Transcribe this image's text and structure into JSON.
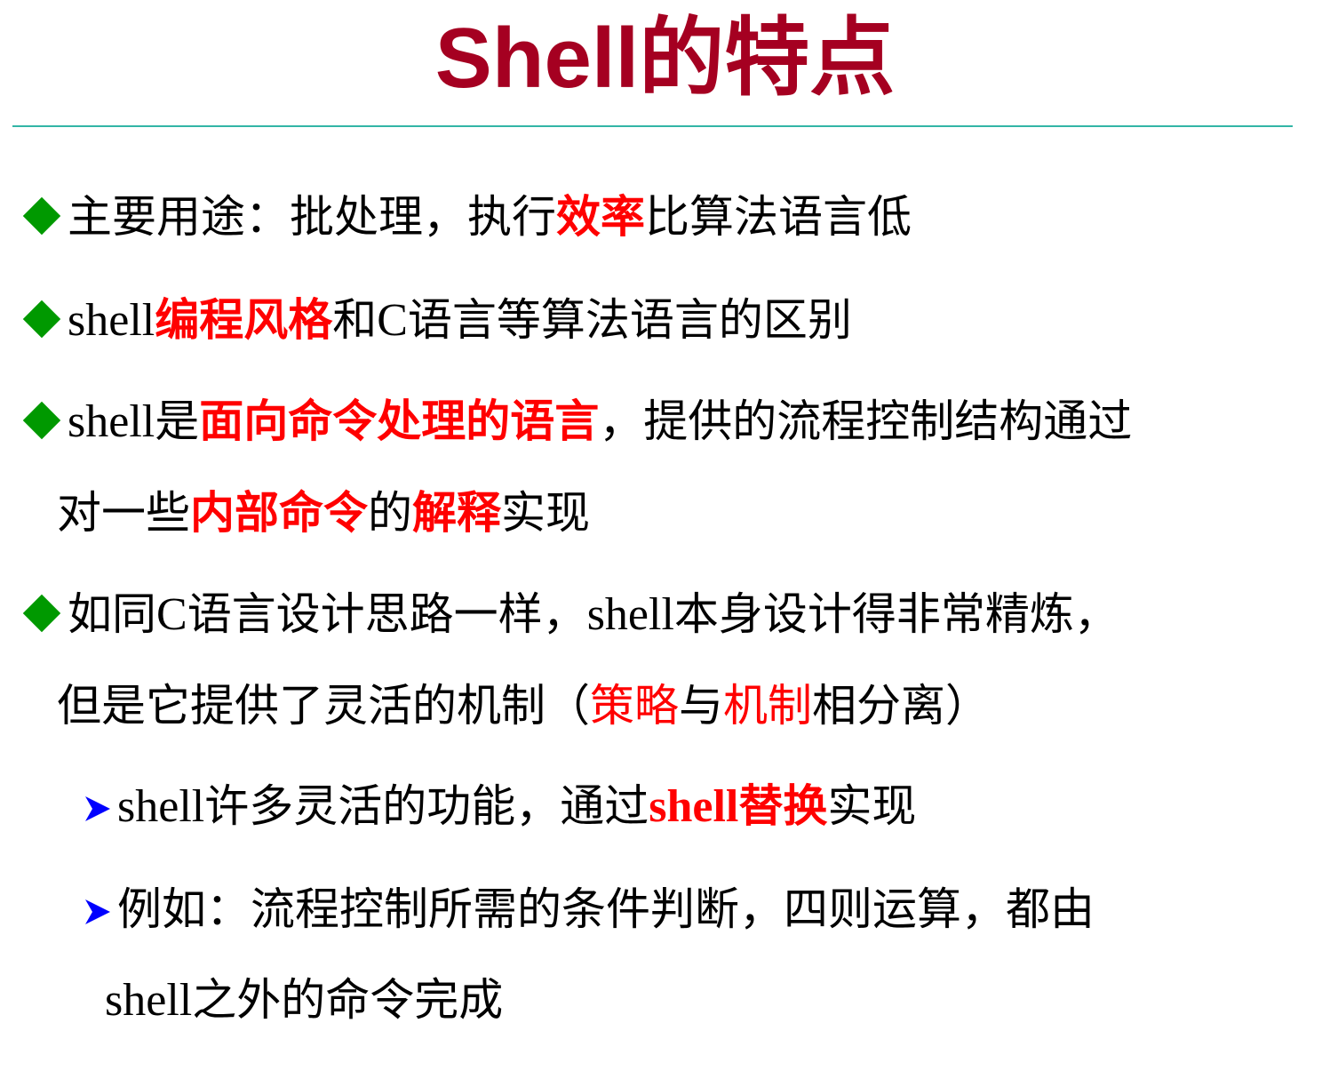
{
  "title": "Shell的特点",
  "colors": {
    "title": "#a50021",
    "rule": "#33b5a6",
    "diamond_bullet": "#009900",
    "arrow_bullet": "#0000ff",
    "highlight": "#ff0000",
    "text": "#000000"
  },
  "bullets": [
    {
      "icon": "green-diamond",
      "segments": [
        "主要用途：批处理，执行",
        "效率",
        "比算法语言低"
      ]
    },
    {
      "icon": "green-diamond",
      "segments": [
        "shell",
        "编程风格",
        "和",
        "C",
        "语言等算法语言的区别"
      ]
    },
    {
      "icon": "green-diamond",
      "segments": [
        "shell",
        "是",
        "面向命令处理的语言",
        "，提供的流程控制结构通过"
      ],
      "continuation": [
        "对一些",
        "内部命令",
        "的",
        "解释",
        "实现"
      ]
    },
    {
      "icon": "green-diamond",
      "segments": [
        "如同",
        "C",
        "语言设计思路一样，",
        "shell",
        "本身设计得非常精炼，"
      ],
      "continuation": [
        "但是它提供了灵活的机制（",
        "策略",
        "与",
        "机制",
        "相分离）"
      ]
    }
  ],
  "sub_bullets": [
    {
      "icon": "blue-arrow",
      "segments": [
        "shell",
        "许多灵活的功能，通过",
        "shell",
        "替换",
        "实现"
      ]
    },
    {
      "icon": "blue-arrow",
      "segments": [
        "例如：流程控制所需的条件判断，四则运算，都由"
      ],
      "continuation": [
        "shell",
        "之外的命令完成"
      ]
    }
  ]
}
